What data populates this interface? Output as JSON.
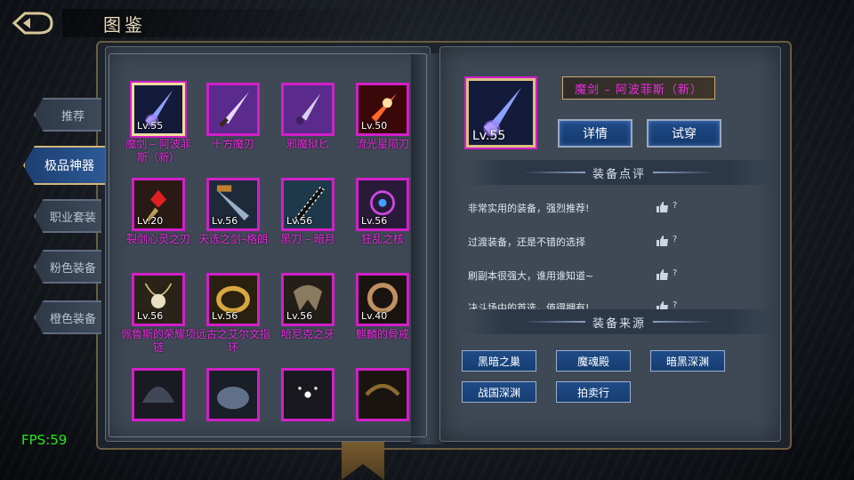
{
  "header": {
    "title": "图鉴"
  },
  "side_tabs": [
    {
      "label": "推荐"
    },
    {
      "label": "极品神器",
      "active": true
    },
    {
      "label": "职业套装"
    },
    {
      "label": "粉色装备"
    },
    {
      "label": "橙色装备"
    }
  ],
  "items": [
    {
      "name": "魔剑 – 阿波菲斯（新）",
      "level": "Lv.55",
      "icon": "dark-sword-icon",
      "selected": true
    },
    {
      "name": "十方魔刃",
      "level": "",
      "icon": "purple-blade-icon"
    },
    {
      "name": "邪魔狱匕",
      "level": "",
      "icon": "purple-dagger-icon"
    },
    {
      "name": "流光星陨刀",
      "level": "Lv.50",
      "icon": "fire-blade-icon"
    },
    {
      "name": "裂剑心灵之刃",
      "level": "Lv.20",
      "icon": "red-gem-sword-icon"
    },
    {
      "name": "天选之剑–格朗",
      "level": "Lv.56",
      "icon": "great-sword-icon"
    },
    {
      "name": "黑刀 – 暗月",
      "level": "Lv.56",
      "icon": "katana-icon"
    },
    {
      "name": "狂乱之核",
      "level": "Lv.56",
      "icon": "chaos-core-icon"
    },
    {
      "name": "佩鲁斯的荣耀项链",
      "level": "Lv.56",
      "icon": "necklace-icon"
    },
    {
      "name": "远古之艾尔文指环",
      "level": "Lv.56",
      "icon": "gold-ring-icon"
    },
    {
      "name": "哈尼克之牙",
      "level": "Lv.56",
      "icon": "fang-icon"
    },
    {
      "name": "麒麟的骨戒",
      "level": "Lv.40",
      "icon": "bone-ring-icon"
    },
    {
      "name": "",
      "level": "",
      "icon": "helmet-icon"
    },
    {
      "name": "",
      "level": "",
      "icon": "armor-icon"
    },
    {
      "name": "",
      "level": "",
      "icon": "crystal-icon"
    },
    {
      "name": "",
      "level": "",
      "icon": "belt-icon"
    }
  ],
  "detail": {
    "name": "魔剑 – 阿波菲斯（新）",
    "level": "Lv.55",
    "icon": "dark-sword-icon",
    "details_button": "详情",
    "try_button": "试穿"
  },
  "reviews_section": {
    "title": "装备点评",
    "reviews": [
      {
        "text": "非常实用的装备，强烈推荐!",
        "likes": "?"
      },
      {
        "text": "过渡装备，还是不错的选择",
        "likes": "?"
      },
      {
        "text": "刷副本很强大，谁用谁知道~",
        "likes": "?"
      },
      {
        "text": "决斗场中的首选，值得拥有!",
        "likes": "?"
      }
    ]
  },
  "source_section": {
    "title": "装备来源",
    "sources": [
      "黑暗之巢",
      "魔魂殿",
      "暗黑深渊",
      "战国深渊",
      "拍卖行"
    ]
  },
  "fps": "FPS:59",
  "colors": {
    "rarity_border": "#d21fc8",
    "item_name": "#ea2de0",
    "button_blue": "#1f4b88",
    "fps": "#23e61c"
  }
}
